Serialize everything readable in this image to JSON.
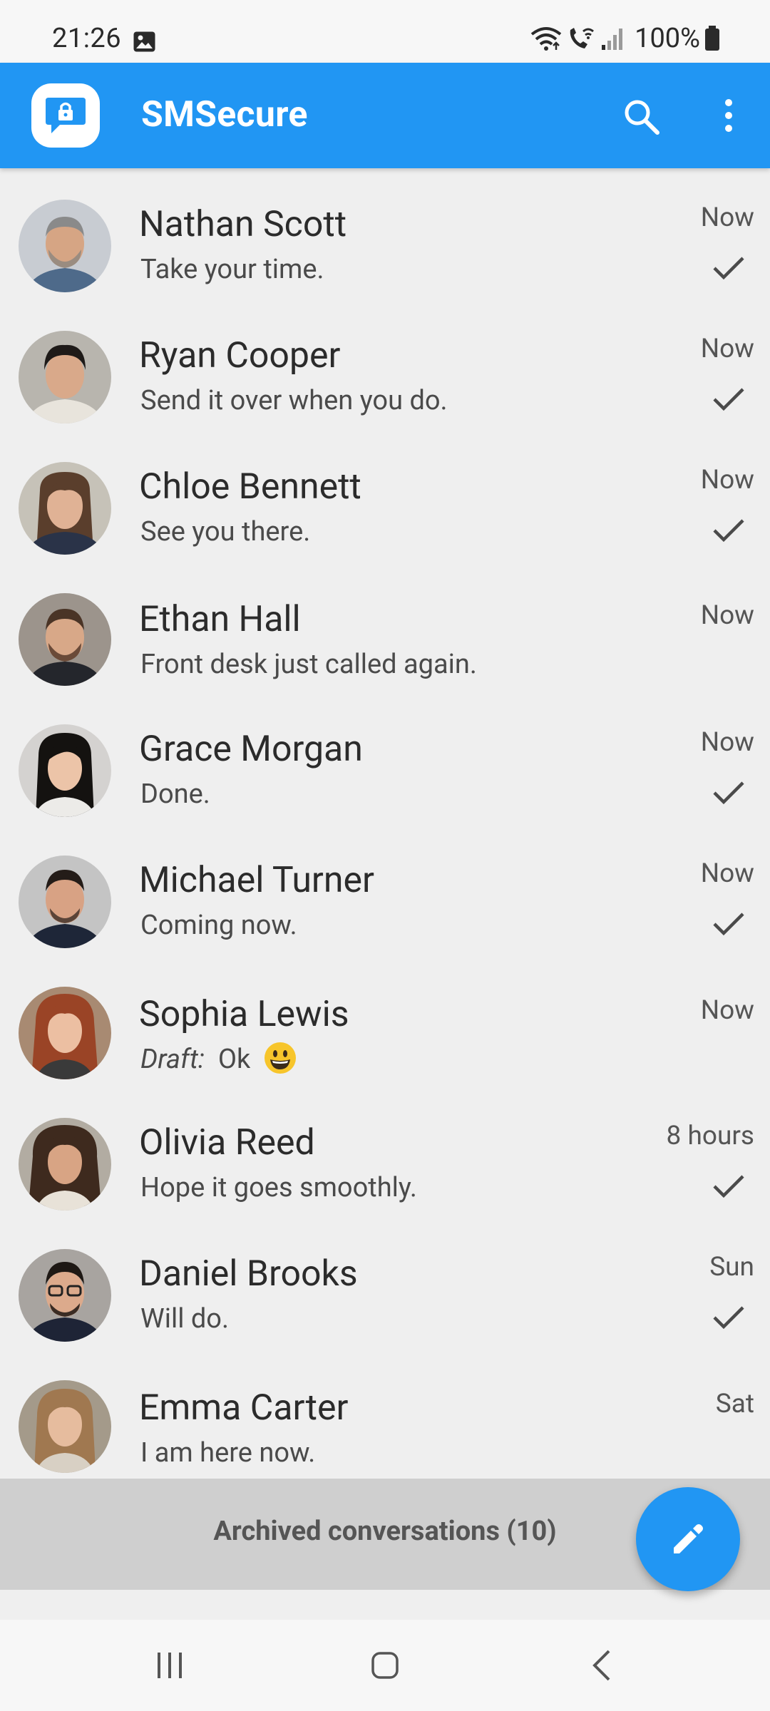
{
  "status_bar": {
    "time": "21:26",
    "battery": "100%",
    "icons": [
      "gallery-icon",
      "wifi-icon",
      "wifi-calling-icon",
      "signal-icon",
      "battery-icon"
    ]
  },
  "app_bar": {
    "title": "SMSecure",
    "icons": [
      "app-logo-icon",
      "search-icon",
      "more-vert-icon"
    ],
    "color": "#2196f3"
  },
  "conversations": [
    {
      "name": "Nathan Scott",
      "snippet": "Take your time.",
      "date": "Now",
      "delivered": true
    },
    {
      "name": "Ryan Cooper",
      "snippet": "Send it over when you do.",
      "date": "Now",
      "delivered": true
    },
    {
      "name": "Chloe Bennett",
      "snippet": "See you there.",
      "date": "Now",
      "delivered": true
    },
    {
      "name": "Ethan Hall",
      "snippet": "Front desk just called again.",
      "date": "Now",
      "delivered": false
    },
    {
      "name": "Grace Morgan",
      "snippet": "Done.",
      "date": "Now",
      "delivered": true
    },
    {
      "name": "Michael Turner",
      "snippet": "Coming now.",
      "date": "Now",
      "delivered": true
    },
    {
      "name": "Sophia Lewis",
      "draft_label": "Draft:",
      "snippet": "Ok",
      "emoji": "grinning-face-emoji",
      "date": "Now",
      "delivered": false
    },
    {
      "name": "Olivia Reed",
      "snippet": "Hope it goes smoothly.",
      "date": "8 hours",
      "delivered": true
    },
    {
      "name": "Daniel Brooks",
      "snippet": "Will do.",
      "date": "Sun",
      "delivered": true
    },
    {
      "name": "Emma Carter",
      "snippet": "I am here now.",
      "date": "Sat",
      "delivered": false
    }
  ],
  "archived": {
    "label": "Archived conversations (10)"
  },
  "fab": {
    "icon": "compose-pencil-icon"
  },
  "nav_bar": {
    "icons": [
      "recent-apps-icon",
      "home-icon",
      "back-icon"
    ]
  }
}
